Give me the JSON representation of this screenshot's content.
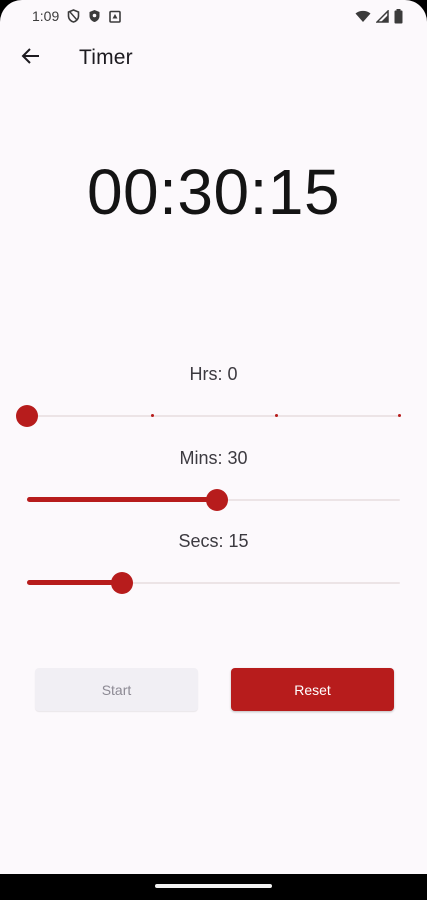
{
  "status_bar": {
    "time": "1:09",
    "icons_left": [
      "vpn-shield-icon",
      "shield-icon",
      "clipboard-icon"
    ],
    "icons_right": [
      "wifi-icon",
      "signal-icon",
      "battery-icon"
    ]
  },
  "app_bar": {
    "title": "Timer",
    "back_icon": "arrow-back-icon"
  },
  "timer": {
    "display": "00:30:15"
  },
  "sliders": {
    "hours": {
      "label": "Hrs: 0",
      "value": 0,
      "min": 0,
      "max": 3,
      "divisions": 3
    },
    "minutes": {
      "label": "Mins: 30",
      "value": 30,
      "min": 0,
      "max": 59
    },
    "seconds": {
      "label": "Secs: 15",
      "value": 15,
      "min": 0,
      "max": 59
    }
  },
  "buttons": {
    "start_label": "Start",
    "reset_label": "Reset",
    "start_enabled": false
  },
  "colors": {
    "accent": "#b71c1c",
    "background": "#fcf9fc"
  }
}
